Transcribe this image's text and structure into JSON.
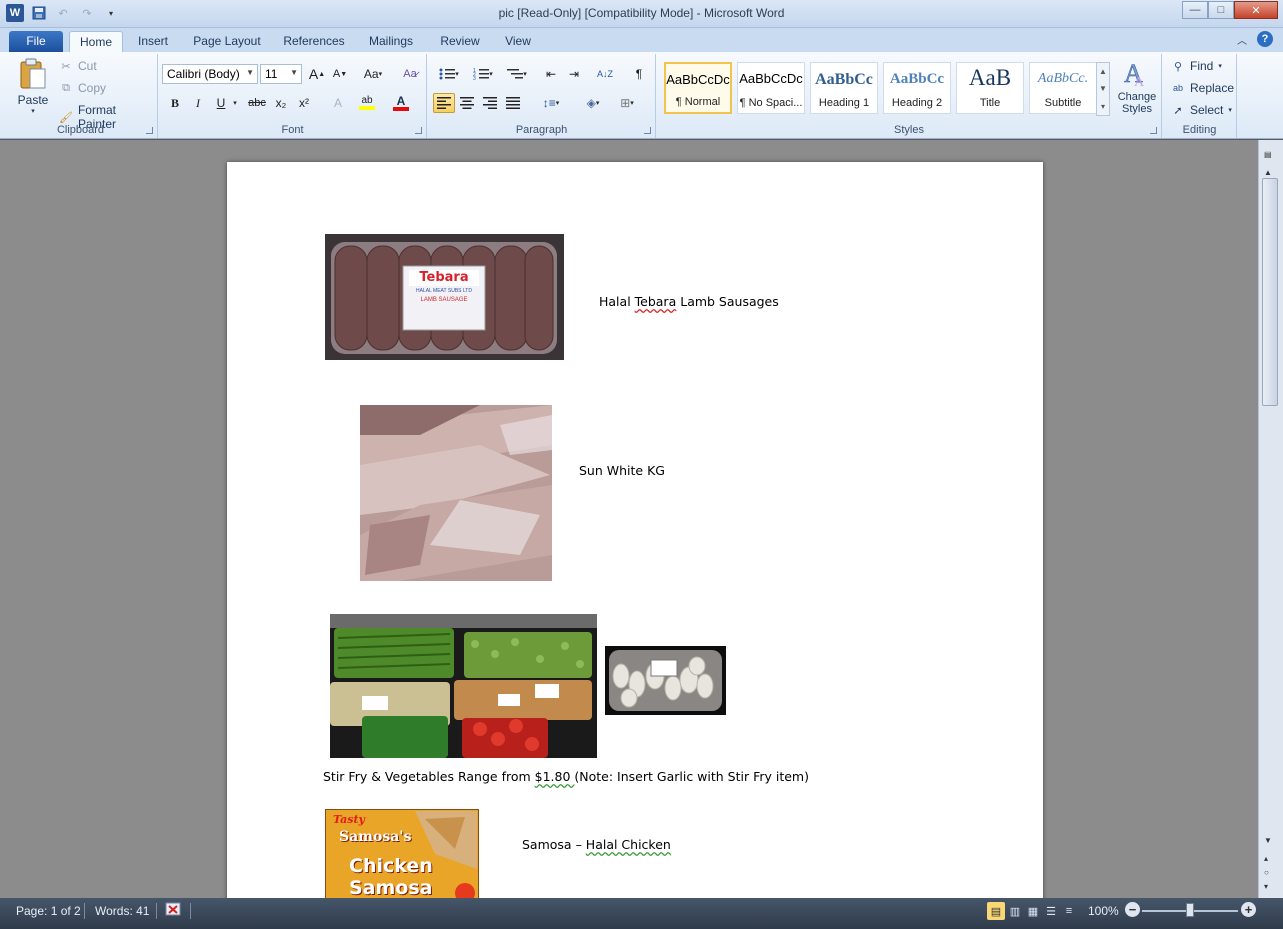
{
  "titlebar": {
    "title": "pic [Read-Only] [Compatibility Mode]  -  Microsoft Word",
    "logo_letter": "W",
    "minimize": "—",
    "maximize": "□",
    "close": "✕"
  },
  "tabs": {
    "file": "File",
    "home": "Home",
    "insert": "Insert",
    "page_layout": "Page Layout",
    "references": "References",
    "mailings": "Mailings",
    "review": "Review",
    "view": "View",
    "help": "?"
  },
  "clipboard": {
    "paste": "Paste",
    "cut": "Cut",
    "copy": "Copy",
    "format_painter": "Format Painter",
    "label": "Clipboard"
  },
  "font": {
    "family": "Calibri (Body)",
    "size": "11",
    "grow": "A",
    "shrink": "A",
    "change_case": "Aa",
    "bold": "B",
    "italic": "I",
    "underline": "U",
    "strike": "abc",
    "subscript": "x₂",
    "superscript": "x²",
    "highlight": "ab",
    "font_color": "A",
    "label": "Font"
  },
  "paragraph": {
    "show_marks": "¶",
    "label": "Paragraph"
  },
  "styles": {
    "items": [
      {
        "preview": "AaBbCcDc",
        "name": "¶ Normal"
      },
      {
        "preview": "AaBbCcDc",
        "name": "¶ No Spaci..."
      },
      {
        "preview": "AaBbCc",
        "name": "Heading 1"
      },
      {
        "preview": "AaBbCc",
        "name": "Heading 2"
      },
      {
        "preview": "AaB",
        "name": "Title"
      },
      {
        "preview": "AaBbCc.",
        "name": "Subtitle"
      }
    ],
    "change_styles": "Change Styles",
    "label": "Styles"
  },
  "editing": {
    "find": "Find",
    "replace": "Replace",
    "select": "Select",
    "label": "Editing"
  },
  "document": {
    "item1": {
      "pre": "Halal ",
      "brand": "Tebara",
      "post": " Lamb Sausages"
    },
    "item2": {
      "text": "Sun White KG"
    },
    "item3": {
      "pre": "Stir Fry & Vegetables Range from ",
      "price": "$1.80 ",
      "post": " (Note: Insert Garlic with Stir Fry item)"
    },
    "item4": {
      "pre": "Samosa – ",
      "name": "Halal  Chicken"
    },
    "samosa_pack": {
      "brand": "Tasty",
      "line1": "Samosa's",
      "line2": "Chicken",
      "line3": "Samosa"
    },
    "sausage_label": {
      "brand": "Tebara",
      "sub": "HALAL MEAT SUBS LTD",
      "product": "LAMB SAUSAGE"
    }
  },
  "statusbar": {
    "page": "Page: 1 of 2",
    "words": "Words: 41",
    "zoom": "100%",
    "zoom_out": "−",
    "zoom_in": "+"
  }
}
